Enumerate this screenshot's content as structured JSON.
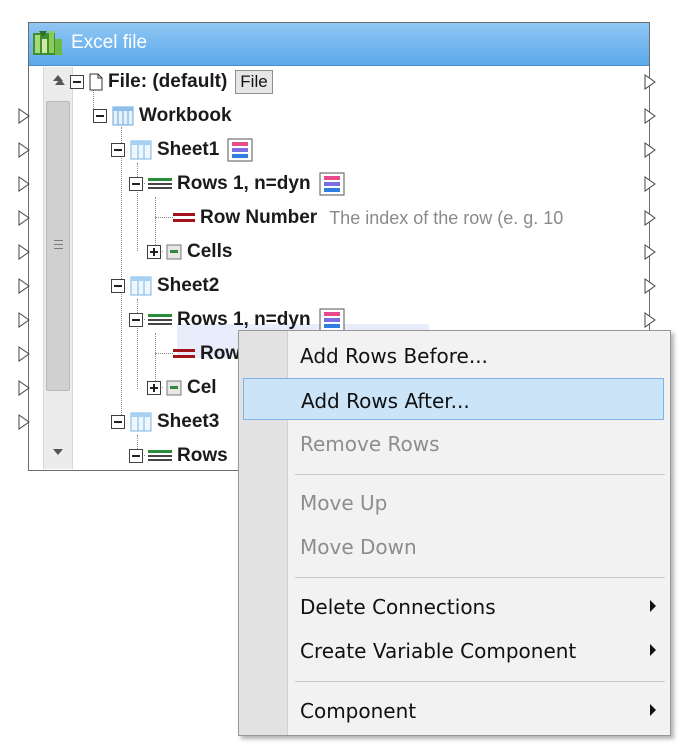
{
  "component": {
    "title": "Excel file",
    "tree": {
      "file": {
        "label": "File: (default)",
        "button": "File"
      },
      "workbook": {
        "label": "Workbook"
      },
      "sheet1": {
        "label": "Sheet1",
        "rows": {
          "label": "Rows 1, n=dyn"
        },
        "row_number": {
          "label": "Row Number",
          "annotation": "The index of the row (e. g. 10"
        },
        "cells": {
          "label": "Cells"
        }
      },
      "sheet2": {
        "label": "Sheet2",
        "rows": {
          "label": "Rows 1, n=dyn"
        },
        "row_number": {
          "label": "Row"
        },
        "cells": {
          "label": "Cel"
        }
      },
      "sheet3": {
        "label": "Sheet3",
        "rows": {
          "label": "Rows"
        }
      }
    }
  },
  "context_menu": {
    "items": [
      {
        "label": "Add Rows Before...",
        "disabled": false
      },
      {
        "label": "Add Rows After...",
        "disabled": false,
        "highlighted": true
      },
      {
        "label": "Remove Rows",
        "disabled": true
      },
      {
        "label": "Move Up",
        "disabled": true
      },
      {
        "label": "Move Down",
        "disabled": true
      },
      {
        "label": "Delete Connections",
        "disabled": false,
        "submenu": true
      },
      {
        "label": "Create Variable Component",
        "disabled": false,
        "submenu": true
      },
      {
        "label": "Component",
        "disabled": false,
        "submenu": true
      }
    ]
  },
  "colors": {
    "title_bar": "#5da9ea",
    "menu_highlight": "#cce4f7",
    "row_highlight": "#e8ecfb"
  }
}
